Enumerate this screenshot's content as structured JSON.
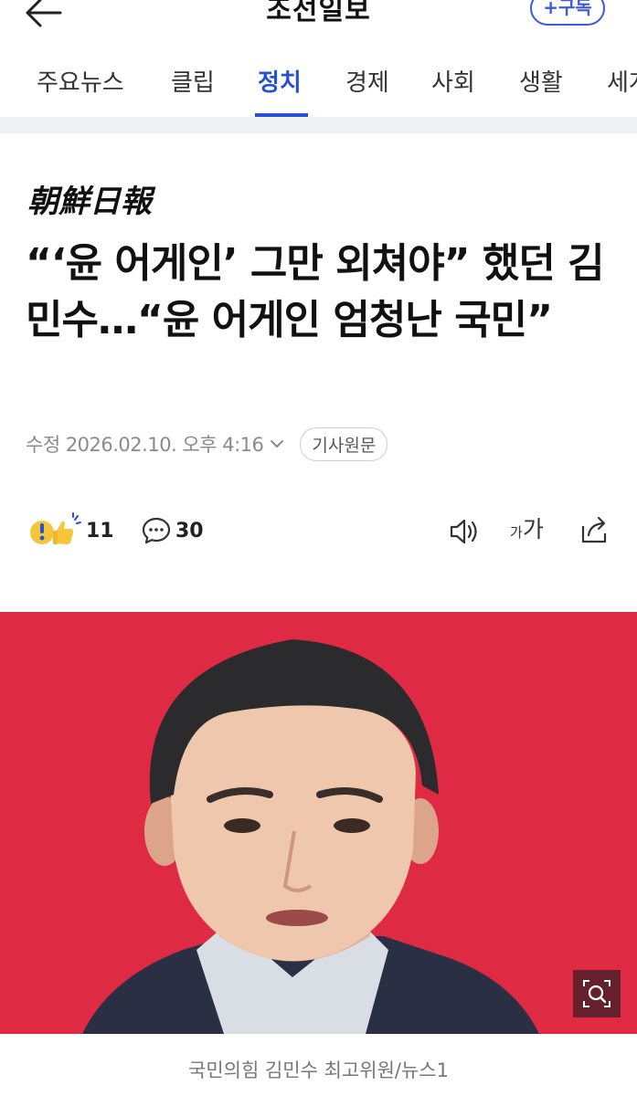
{
  "header": {
    "title": "조선일보",
    "subscribe_label": "+구독"
  },
  "tabs": [
    {
      "label": "주요뉴스",
      "active": false
    },
    {
      "label": "클립",
      "active": false
    },
    {
      "label": "정치",
      "active": true
    },
    {
      "label": "경제",
      "active": false
    },
    {
      "label": "사회",
      "active": false
    },
    {
      "label": "생활",
      "active": false
    },
    {
      "label": "세계",
      "active": false
    }
  ],
  "article": {
    "masthead": "朝鮮日報",
    "headline": "“‘윤 어게인’ 그만 외쳐야” 했던 김민수…“윤 어게인 엄청난 국민”",
    "date": "수정 2026.02.10. 오후 4:16",
    "original_label": "기사원문",
    "reaction_count": "11",
    "comment_count": "30",
    "fontsize_small": "가",
    "fontsize_big": "가",
    "photo_caption": "국민의힘 김민수 최고위원/뉴스1"
  },
  "colors": {
    "accent": "#2450d6",
    "photo_background": "#df2a44"
  },
  "icons": {
    "back": "back-arrow-icon",
    "chevron": "chevron-down-icon",
    "reaction": "emoji-reaction-icon",
    "comment": "comment-icon",
    "speaker": "speaker-icon",
    "share": "share-icon",
    "zoom": "zoom-icon"
  }
}
